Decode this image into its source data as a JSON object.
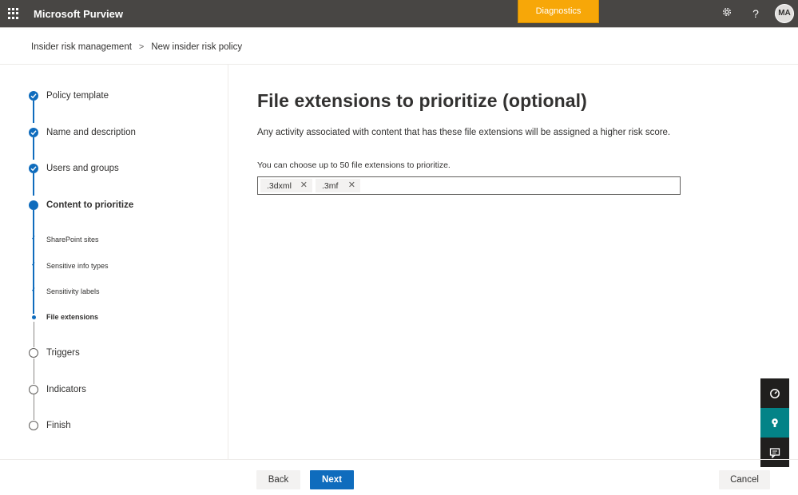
{
  "header": {
    "app_title": "Microsoft Purview",
    "diagnostics_label": "Diagnostics",
    "settings_icon": "gear-icon",
    "help_label": "?",
    "avatar_initials": "MA",
    "colors": {
      "bar": "#484644",
      "diagnostics": "#f7a708"
    }
  },
  "breadcrumb": {
    "items": [
      "Insider risk management",
      "New insider risk policy"
    ],
    "separator": ">"
  },
  "steps": [
    {
      "label": "Policy template",
      "state": "done"
    },
    {
      "label": "Name and description",
      "state": "done"
    },
    {
      "label": "Users and groups",
      "state": "done"
    },
    {
      "label": "Content to prioritize",
      "state": "current"
    },
    {
      "label": "Triggers",
      "state": "todo"
    },
    {
      "label": "Indicators",
      "state": "todo"
    },
    {
      "label": "Finish",
      "state": "todo"
    }
  ],
  "substeps": [
    {
      "label": "SharePoint sites",
      "state": "done"
    },
    {
      "label": "Sensitive info types",
      "state": "done"
    },
    {
      "label": "Sensitivity labels",
      "state": "done"
    },
    {
      "label": "File extensions",
      "state": "current"
    }
  ],
  "main": {
    "title": "File extensions to prioritize (optional)",
    "description": "Any activity associated with content that has these file extensions will be assigned a higher risk score.",
    "field_label": "You can choose up to 50 file extensions to prioritize.",
    "tags": [
      ".3dxml",
      ".3mf"
    ],
    "remove_glyph": "✕"
  },
  "footer": {
    "back_label": "Back",
    "next_label": "Next",
    "cancel_label": "Cancel",
    "accent": "#0f6cbd"
  },
  "floating_tools": [
    "gauge-icon",
    "person-help-icon",
    "feedback-icon"
  ]
}
